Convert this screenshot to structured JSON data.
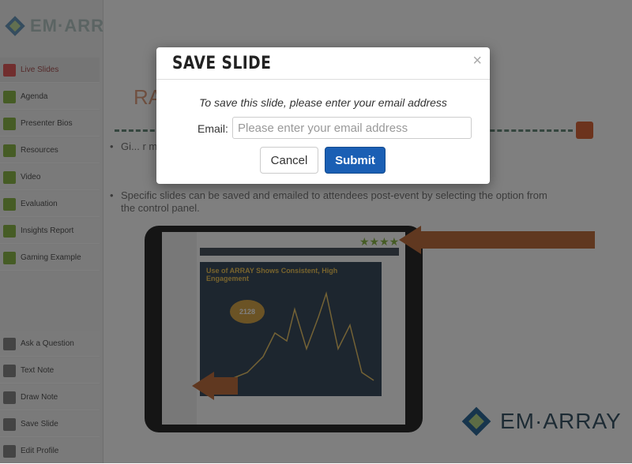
{
  "app": {
    "logo_text": "EM·ARRAY"
  },
  "sidebar": {
    "items": [
      {
        "label": "Live Slides",
        "icon": "slides-icon"
      },
      {
        "label": "Agenda",
        "icon": "agenda-icon"
      },
      {
        "label": "Presenter Bios",
        "icon": "presenter-icon"
      },
      {
        "label": "Resources",
        "icon": "resources-icon"
      },
      {
        "label": "Video",
        "icon": "video-icon"
      },
      {
        "label": "Evaluation",
        "icon": "evaluation-icon"
      },
      {
        "label": "Insights Report",
        "icon": "insights-icon"
      },
      {
        "label": "Gaming Example",
        "icon": "gaming-icon"
      },
      {
        "label": "Ask a Question",
        "icon": "question-icon"
      },
      {
        "label": "Text Note",
        "icon": "text-note-icon"
      },
      {
        "label": "Draw Note",
        "icon": "draw-note-icon"
      },
      {
        "label": "Save Slide",
        "icon": "save-slide-icon"
      },
      {
        "label": "Edit Profile",
        "icon": "edit-profile-icon"
      }
    ]
  },
  "slide": {
    "title_partial": "RA",
    "bullet1": "Gi... r marker option. Th... reporting post-ev...",
    "bullet2": "Specific slides can be saved and emailed to attendees post-event by selecting the option from the control panel.",
    "tablet_chart_title": "Use of ARRAY Shows Consistent, High Engagement",
    "tablet_badge": "2128",
    "brand_text": "EM·ARRAY"
  },
  "modal": {
    "title": "SAVE SLIDE",
    "close_glyph": "×",
    "message": "To save this slide, please enter your email address",
    "email_label": "Email:",
    "email_placeholder": "Please enter your email address",
    "email_value": "",
    "cancel_label": "Cancel",
    "submit_label": "Submit"
  },
  "colors": {
    "submit": "#1a5fb4",
    "overlay": "rgba(0,0,0,0.5)",
    "accent_orange": "#d9663b",
    "accent_green": "#8cb84a"
  }
}
